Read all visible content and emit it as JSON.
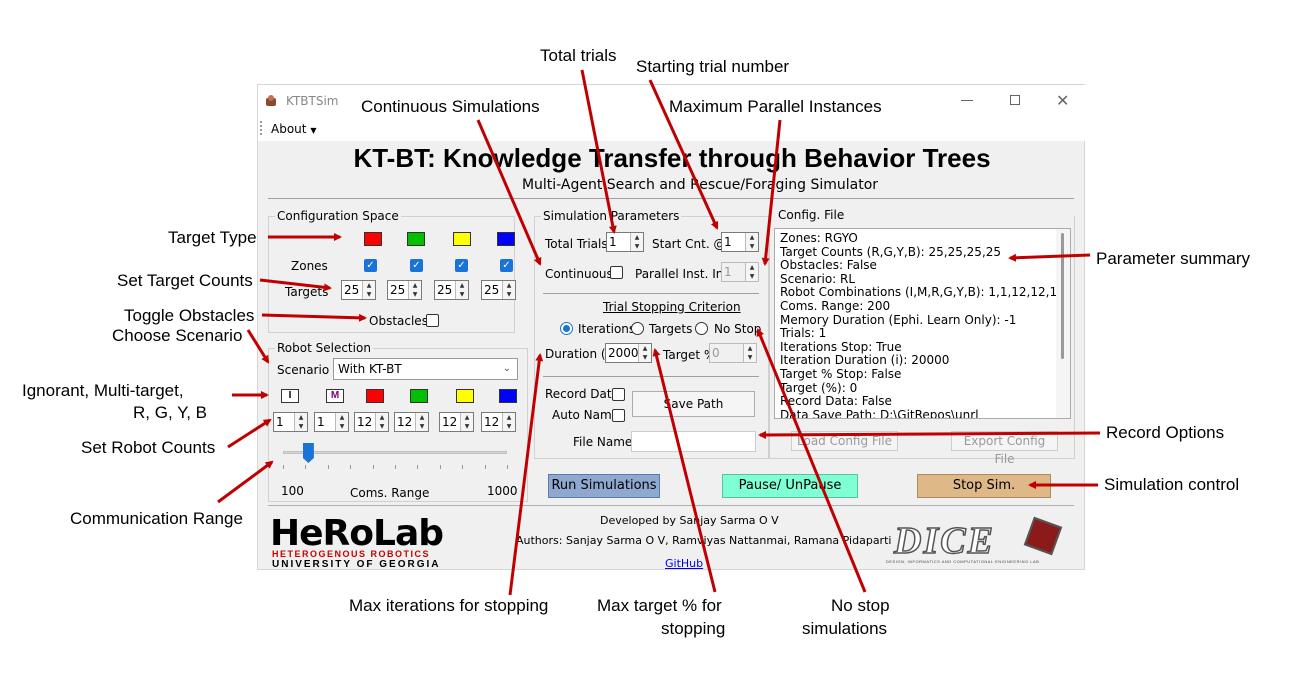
{
  "window": {
    "title": "KTBTSim"
  },
  "menu": {
    "about": "About"
  },
  "header": {
    "title": "KT-BT: Knowledge Transfer through Behavior Trees",
    "subtitle": "Multi-Agent Search and Rescue/Foraging Simulator"
  },
  "config_space": {
    "legend": "Configuration Space",
    "zones_label": "Zones",
    "targets_label": "Targets",
    "obstacles_label": "Obstacles",
    "target_colors": [
      "#ff0000",
      "#00c000",
      "#ffff00",
      "#0000ff"
    ],
    "target_counts": [
      "25",
      "25",
      "25",
      "25"
    ],
    "zones_checked": [
      true,
      true,
      true,
      true
    ],
    "obstacles_checked": false
  },
  "robot_selection": {
    "legend": "Robot Selection",
    "scenario_label": "Scenario",
    "scenario_value": "With KT-BT",
    "robot_types": [
      {
        "letter": "I",
        "color": "#ffffff",
        "text_color": "#000000"
      },
      {
        "letter": "M",
        "color": "#ffffff",
        "text_color": "#800080"
      },
      {
        "letter": "",
        "color": "#ff0000"
      },
      {
        "letter": "",
        "color": "#00c000"
      },
      {
        "letter": "",
        "color": "#ffff00"
      },
      {
        "letter": "",
        "color": "#0000ff"
      }
    ],
    "robot_counts": [
      "1",
      "1",
      "12",
      "12",
      "12",
      "12"
    ],
    "range_min": "100",
    "range_max": "1000",
    "range_label": "Coms. Range",
    "range_value": 200
  },
  "sim_params": {
    "legend": "Simulation Parameters",
    "total_trials_label": "Total Trials",
    "total_trials": "1",
    "start_cnt_label": "Start Cnt. @",
    "start_cnt": "1",
    "continuous_label": "Continuous",
    "parallel_label": "Parallel Inst. Int.",
    "parallel_value": "1",
    "stopping_label": "Trial Stopping Criterion",
    "radio_iterations": "Iterations",
    "radio_targets": "Targets",
    "radio_nostop": "No Stop",
    "duration_label": "Duration (i)",
    "duration_value": "2000",
    "target_pct_label": "Target %",
    "target_pct_value": "0",
    "record_data_label": "Record Data",
    "auto_name_label": "Auto Name",
    "save_path_label": "Save Path",
    "file_name_label": "File Name",
    "file_name_value": ""
  },
  "config_file": {
    "legend": "Config. File",
    "lines": [
      "Zones: RGYO",
      "Target Counts (R,G,Y,B): 25,25,25,25",
      "Obstacles: False",
      "Scenario: RL",
      "Robot Combinations (I,M,R,G,Y,B): 1,1,12,12,12,12",
      "Coms. Range: 200",
      "Memory Duration (Ephi. Learn Only): -1",
      "Trials: 1",
      "Iterations Stop: True",
      "Iteration Duration (i): 20000",
      "Target % Stop: False",
      "Target (%): 0",
      "Record Data: False",
      "Data Save Path: D:\\GitRepos\\unrl"
    ],
    "load_label": "Load Config File",
    "export_label": "Export Config File"
  },
  "controls": {
    "run_label": "Run Simulations",
    "pause_label": "Pause/ UnPause",
    "stop_label": "Stop Sim.",
    "run_color": "#8fa8d0",
    "pause_color": "#7fffd4",
    "stop_color": "#deb887"
  },
  "footer": {
    "logo_text": "HeRoLab",
    "logo_sub": "HETEROGENOUS ROBOTICS",
    "logo_univ": "UNIVERSITY OF GEORGIA",
    "developed": "Developed by Sanjay Sarma O V",
    "authors": "Authors: Sanjay Sarma O V, Ramviyas Nattanmai, Ramana Pidaparti",
    "github": "GitHub",
    "dice_logo": "DICE",
    "dice_sub": "DESIGN, INFORMATICS AND COMPUTATIONAL ENGINEERING LAB"
  },
  "annotations": {
    "total_trials": "Total trials",
    "starting_trial": "Starting trial number",
    "continuous": "Continuous Simulations",
    "max_parallel": "Maximum Parallel Instances",
    "target_type": "Target Type",
    "set_target_counts": "Set Target Counts",
    "toggle_obstacles": "Toggle Obstacles",
    "choose_scenario": "Choose Scenario",
    "robot_types_1": "Ignorant, Multi-target,",
    "robot_types_2": "R, G, Y, B",
    "set_robot_counts": "Set Robot Counts",
    "com_range": "Communication Range",
    "param_summary": "Parameter summary",
    "record_options": "Record Options",
    "sim_control": "Simulation control",
    "max_iter": "Max iterations for stopping",
    "max_target_1": "Max target % for",
    "max_target_2": "stopping",
    "no_stop_1": "No stop",
    "no_stop_2": "simulations"
  }
}
